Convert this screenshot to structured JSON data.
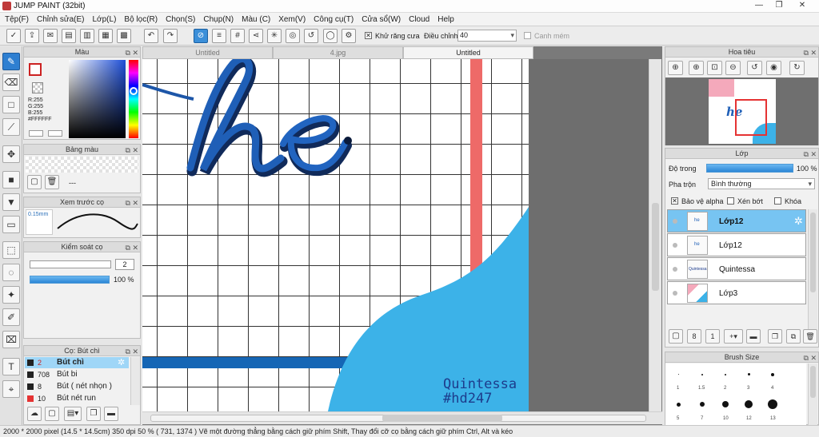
{
  "app": {
    "title": "JUMP PAINT (32bit)"
  },
  "menu": [
    "Tệp(F)",
    "Chỉnh sửa(E)",
    "Lớp(L)",
    "Bộ lọc(R)",
    "Chọn(S)",
    "Chụp(N)",
    "Màu (C)",
    "Xem(V)",
    "Công cụ(T)",
    "Cửa sổ(W)",
    "Cloud",
    "Help"
  ],
  "toolbar": {
    "antialias_label": "Khử răng cưa",
    "adjust_label": "Điều chỉnh",
    "adjust_value": "40",
    "snap_label": "Canh mém"
  },
  "color_panel": {
    "title": "Màu",
    "r": "R:255",
    "g": "G:255",
    "b": "B:255",
    "hex": "#FFFFFF"
  },
  "palette_panel": {
    "title": "Bảng màu",
    "dashes": "---"
  },
  "brush_preview": {
    "title": "Xem trước cọ",
    "size": "0.15mm"
  },
  "brush_control": {
    "title": "Kiểm soát cọ",
    "size_value": "2",
    "opacity_value": "100 %"
  },
  "brush_list": {
    "title": "Cọ: Bút chì",
    "items": [
      {
        "size": "2",
        "name": "Bút chì",
        "color": "#cc2222"
      },
      {
        "size": "708",
        "name": "Bút bi",
        "color": "#222222"
      },
      {
        "size": "8",
        "name": "Bút ( nét nhọn )",
        "color": "#222222"
      },
      {
        "size": "10",
        "name": "Bút nét run",
        "color": "#cc2222"
      }
    ]
  },
  "tabs": [
    "Untitled",
    "4.jpg",
    "Untitled"
  ],
  "canvas": {
    "signature_line1": "Quintessa",
    "signature_line2": "#hd247",
    "lettering": "he"
  },
  "navigator": {
    "title": "Hoa tiêu",
    "thumb_text": "he"
  },
  "layers_panel": {
    "title": "Lớp",
    "opacity_label": "Độ trong",
    "opacity_value": "100 %",
    "blend_label": "Pha trộn",
    "blend_value": "Bình thường",
    "alpha_label": "Bảo vệ alpha",
    "clip_label": "Xén bớt",
    "lock_label": "Khóa",
    "layers": [
      {
        "name": "Lớp12",
        "active": true
      },
      {
        "name": "Lớp12",
        "active": false
      },
      {
        "name": "Quintessa",
        "active": false
      },
      {
        "name": "Lớp3",
        "active": false
      }
    ]
  },
  "brush_size_panel": {
    "title": "Brush Size",
    "labels": [
      "1",
      "1.5",
      "2",
      "3",
      "4",
      "5",
      "7",
      "10",
      "12",
      "13"
    ]
  },
  "status": {
    "text": "2000 * 2000 pixel  (14.5 * 14.5cm)  350 dpi  50 %  ( 731, 1374 )  Vẽ một đường thẳng bằng cách giữ phím Shift, Thay đổi cỡ cọ bằng cách giữ phím Ctrl, Alt và kéo"
  },
  "colors": {
    "accent": "#2e7fd1",
    "sky_blue": "#3cb2e8",
    "lettering_blue": "#1d56a8",
    "coral": "#ee6a68",
    "stripe_blue": "#1566b5"
  }
}
